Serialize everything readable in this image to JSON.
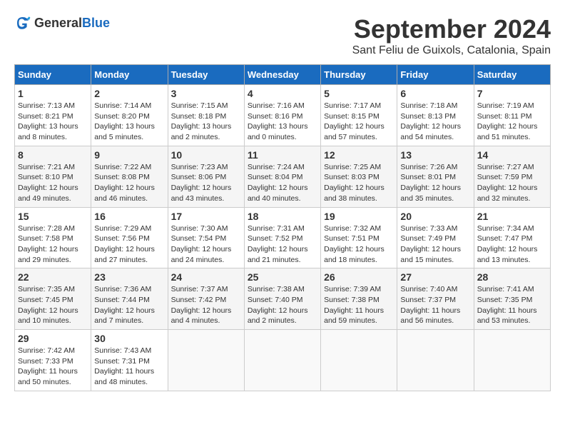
{
  "header": {
    "logo_general": "General",
    "logo_blue": "Blue",
    "month_title": "September 2024",
    "location": "Sant Feliu de Guixols, Catalonia, Spain"
  },
  "days_of_week": [
    "Sunday",
    "Monday",
    "Tuesday",
    "Wednesday",
    "Thursday",
    "Friday",
    "Saturday"
  ],
  "weeks": [
    [
      {
        "day": "1",
        "sunrise": "7:13 AM",
        "sunset": "8:21 PM",
        "daylight": "13 hours and 8 minutes."
      },
      {
        "day": "2",
        "sunrise": "7:14 AM",
        "sunset": "8:20 PM",
        "daylight": "13 hours and 5 minutes."
      },
      {
        "day": "3",
        "sunrise": "7:15 AM",
        "sunset": "8:18 PM",
        "daylight": "13 hours and 2 minutes."
      },
      {
        "day": "4",
        "sunrise": "7:16 AM",
        "sunset": "8:16 PM",
        "daylight": "13 hours and 0 minutes."
      },
      {
        "day": "5",
        "sunrise": "7:17 AM",
        "sunset": "8:15 PM",
        "daylight": "12 hours and 57 minutes."
      },
      {
        "day": "6",
        "sunrise": "7:18 AM",
        "sunset": "8:13 PM",
        "daylight": "12 hours and 54 minutes."
      },
      {
        "day": "7",
        "sunrise": "7:19 AM",
        "sunset": "8:11 PM",
        "daylight": "12 hours and 51 minutes."
      }
    ],
    [
      {
        "day": "8",
        "sunrise": "7:21 AM",
        "sunset": "8:10 PM",
        "daylight": "12 hours and 49 minutes."
      },
      {
        "day": "9",
        "sunrise": "7:22 AM",
        "sunset": "8:08 PM",
        "daylight": "12 hours and 46 minutes."
      },
      {
        "day": "10",
        "sunrise": "7:23 AM",
        "sunset": "8:06 PM",
        "daylight": "12 hours and 43 minutes."
      },
      {
        "day": "11",
        "sunrise": "7:24 AM",
        "sunset": "8:04 PM",
        "daylight": "12 hours and 40 minutes."
      },
      {
        "day": "12",
        "sunrise": "7:25 AM",
        "sunset": "8:03 PM",
        "daylight": "12 hours and 38 minutes."
      },
      {
        "day": "13",
        "sunrise": "7:26 AM",
        "sunset": "8:01 PM",
        "daylight": "12 hours and 35 minutes."
      },
      {
        "day": "14",
        "sunrise": "7:27 AM",
        "sunset": "7:59 PM",
        "daylight": "12 hours and 32 minutes."
      }
    ],
    [
      {
        "day": "15",
        "sunrise": "7:28 AM",
        "sunset": "7:58 PM",
        "daylight": "12 hours and 29 minutes."
      },
      {
        "day": "16",
        "sunrise": "7:29 AM",
        "sunset": "7:56 PM",
        "daylight": "12 hours and 27 minutes."
      },
      {
        "day": "17",
        "sunrise": "7:30 AM",
        "sunset": "7:54 PM",
        "daylight": "12 hours and 24 minutes."
      },
      {
        "day": "18",
        "sunrise": "7:31 AM",
        "sunset": "7:52 PM",
        "daylight": "12 hours and 21 minutes."
      },
      {
        "day": "19",
        "sunrise": "7:32 AM",
        "sunset": "7:51 PM",
        "daylight": "12 hours and 18 minutes."
      },
      {
        "day": "20",
        "sunrise": "7:33 AM",
        "sunset": "7:49 PM",
        "daylight": "12 hours and 15 minutes."
      },
      {
        "day": "21",
        "sunrise": "7:34 AM",
        "sunset": "7:47 PM",
        "daylight": "12 hours and 13 minutes."
      }
    ],
    [
      {
        "day": "22",
        "sunrise": "7:35 AM",
        "sunset": "7:45 PM",
        "daylight": "12 hours and 10 minutes."
      },
      {
        "day": "23",
        "sunrise": "7:36 AM",
        "sunset": "7:44 PM",
        "daylight": "12 hours and 7 minutes."
      },
      {
        "day": "24",
        "sunrise": "7:37 AM",
        "sunset": "7:42 PM",
        "daylight": "12 hours and 4 minutes."
      },
      {
        "day": "25",
        "sunrise": "7:38 AM",
        "sunset": "7:40 PM",
        "daylight": "12 hours and 2 minutes."
      },
      {
        "day": "26",
        "sunrise": "7:39 AM",
        "sunset": "7:38 PM",
        "daylight": "11 hours and 59 minutes."
      },
      {
        "day": "27",
        "sunrise": "7:40 AM",
        "sunset": "7:37 PM",
        "daylight": "11 hours and 56 minutes."
      },
      {
        "day": "28",
        "sunrise": "7:41 AM",
        "sunset": "7:35 PM",
        "daylight": "11 hours and 53 minutes."
      }
    ],
    [
      {
        "day": "29",
        "sunrise": "7:42 AM",
        "sunset": "7:33 PM",
        "daylight": "11 hours and 50 minutes."
      },
      {
        "day": "30",
        "sunrise": "7:43 AM",
        "sunset": "7:31 PM",
        "daylight": "11 hours and 48 minutes."
      },
      null,
      null,
      null,
      null,
      null
    ]
  ]
}
